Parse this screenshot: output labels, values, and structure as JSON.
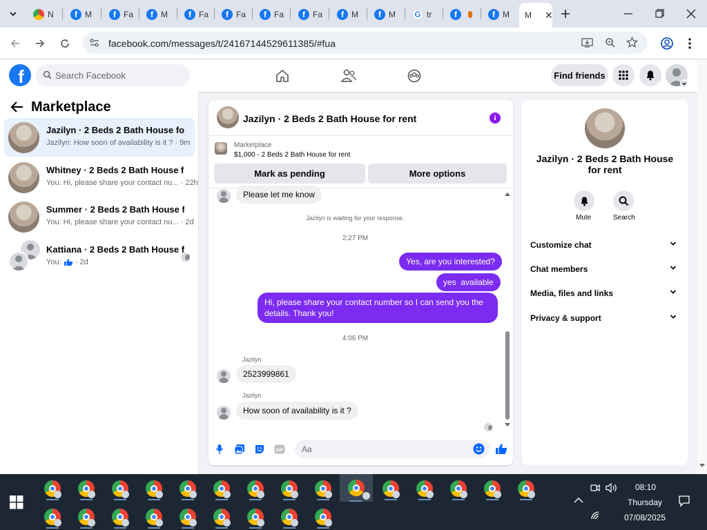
{
  "browser": {
    "tabs": [
      {
        "title": "N",
        "icon": "chrome-icon"
      },
      {
        "title": "M",
        "icon": "facebook-icon"
      },
      {
        "title": "Fa",
        "icon": "facebook-icon"
      },
      {
        "title": "M",
        "icon": "facebook-icon"
      },
      {
        "title": "Fa",
        "icon": "facebook-icon"
      },
      {
        "title": "Fa",
        "icon": "facebook-icon"
      },
      {
        "title": "Fa",
        "icon": "facebook-icon"
      },
      {
        "title": "Fa",
        "icon": "facebook-icon"
      },
      {
        "title": "M",
        "icon": "facebook-icon"
      },
      {
        "title": "M",
        "icon": "facebook-icon"
      },
      {
        "title": "tr",
        "icon": "google-icon"
      },
      {
        "title": "",
        "icon": "facebook-icon"
      },
      {
        "title": "M",
        "icon": "facebook-icon"
      }
    ],
    "active_tab": {
      "title": "M"
    },
    "url": "facebook.com/messages/t/24167144529611385/#fua"
  },
  "facebook": {
    "search_placeholder": "Search Facebook",
    "find_friends_label": "Find friends"
  },
  "sidebar": {
    "title": "Marketplace",
    "conversations": [
      {
        "name": "Jazilyn · 2 Beds 2 Bath House for r...",
        "preview": "Jazilyn: How soon of availability is it ? · 9m"
      },
      {
        "name": "Whitney · 2 Beds 2 Bath House for...",
        "preview": "You: Hi, please share your contact nu... · 22h"
      },
      {
        "name": "Summer · 2 Beds 2 Bath House for...",
        "preview": "You: Hi, please share your contact nu... · 2d"
      },
      {
        "name": "Kattiana · 2 Beds 2 Bath House f...",
        "preview_prefix": "You:",
        "preview_suffix": "· 2d"
      }
    ]
  },
  "chat": {
    "title": "Jazilyn · 2 Beds 2 Bath House for rent",
    "marketplace_label": "Marketplace",
    "listing": "$1,000 - 2 Beds 2 Bath House for rent",
    "mark_pending": "Mark as pending",
    "more_options": "More options",
    "messages": {
      "first_in": "Please let me know",
      "waiting_note": "Jazilyn is waiting for your response.",
      "time1": "2:27 PM",
      "out1": "Yes, are you interested?",
      "out2": "yes  available",
      "out3": "Hi, please share your contact number so I can send you the details. Thank you!",
      "time2": "4:06 PM",
      "sender1": "Jazilyn",
      "in2": "2523999861",
      "sender2": "Jazilyn",
      "in3": "How soon of availability is it ?"
    },
    "composer_placeholder": "Aa"
  },
  "info_panel": {
    "name": "Jazilyn · 2 Beds 2 Bath House for rent",
    "mute_label": "Mute",
    "search_label": "Search",
    "sections": [
      "Customize chat",
      "Chat members",
      "Media, files and links",
      "Privacy & support"
    ]
  },
  "taskbar": {
    "time": "08:10",
    "day": "Thursday",
    "date": "07/08/2025"
  },
  "colors": {
    "facebook_blue": "#1877f2",
    "outgoing_bubble": "#7c2bf0",
    "taskbar": "#1c2733"
  }
}
